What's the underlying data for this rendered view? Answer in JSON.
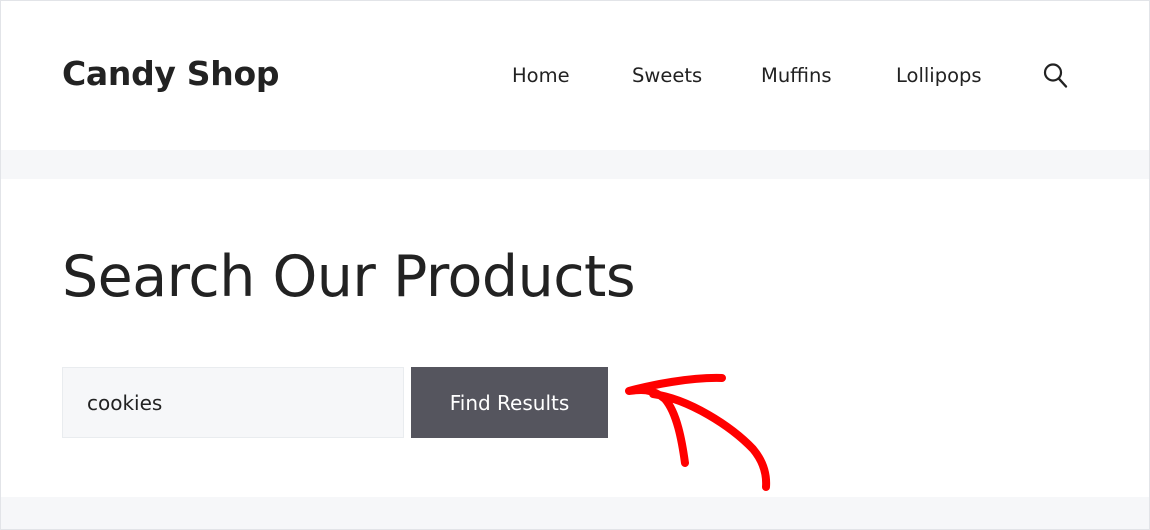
{
  "site": {
    "title": "Candy Shop"
  },
  "nav": {
    "items": [
      {
        "label": "Home"
      },
      {
        "label": "Sweets"
      },
      {
        "label": "Muffins"
      },
      {
        "label": "Lollipops"
      }
    ],
    "search_icon": "search-icon"
  },
  "main": {
    "page_title": "Search Our Products"
  },
  "search": {
    "value": "cookies",
    "button_label": "Find Results"
  },
  "colors": {
    "button_bg": "#55555e",
    "input_bg": "#f6f7f9",
    "page_bg": "#f6f7f9",
    "annotation": "#ff0000"
  },
  "annotation": {
    "icon": "red-arrow-icon"
  }
}
